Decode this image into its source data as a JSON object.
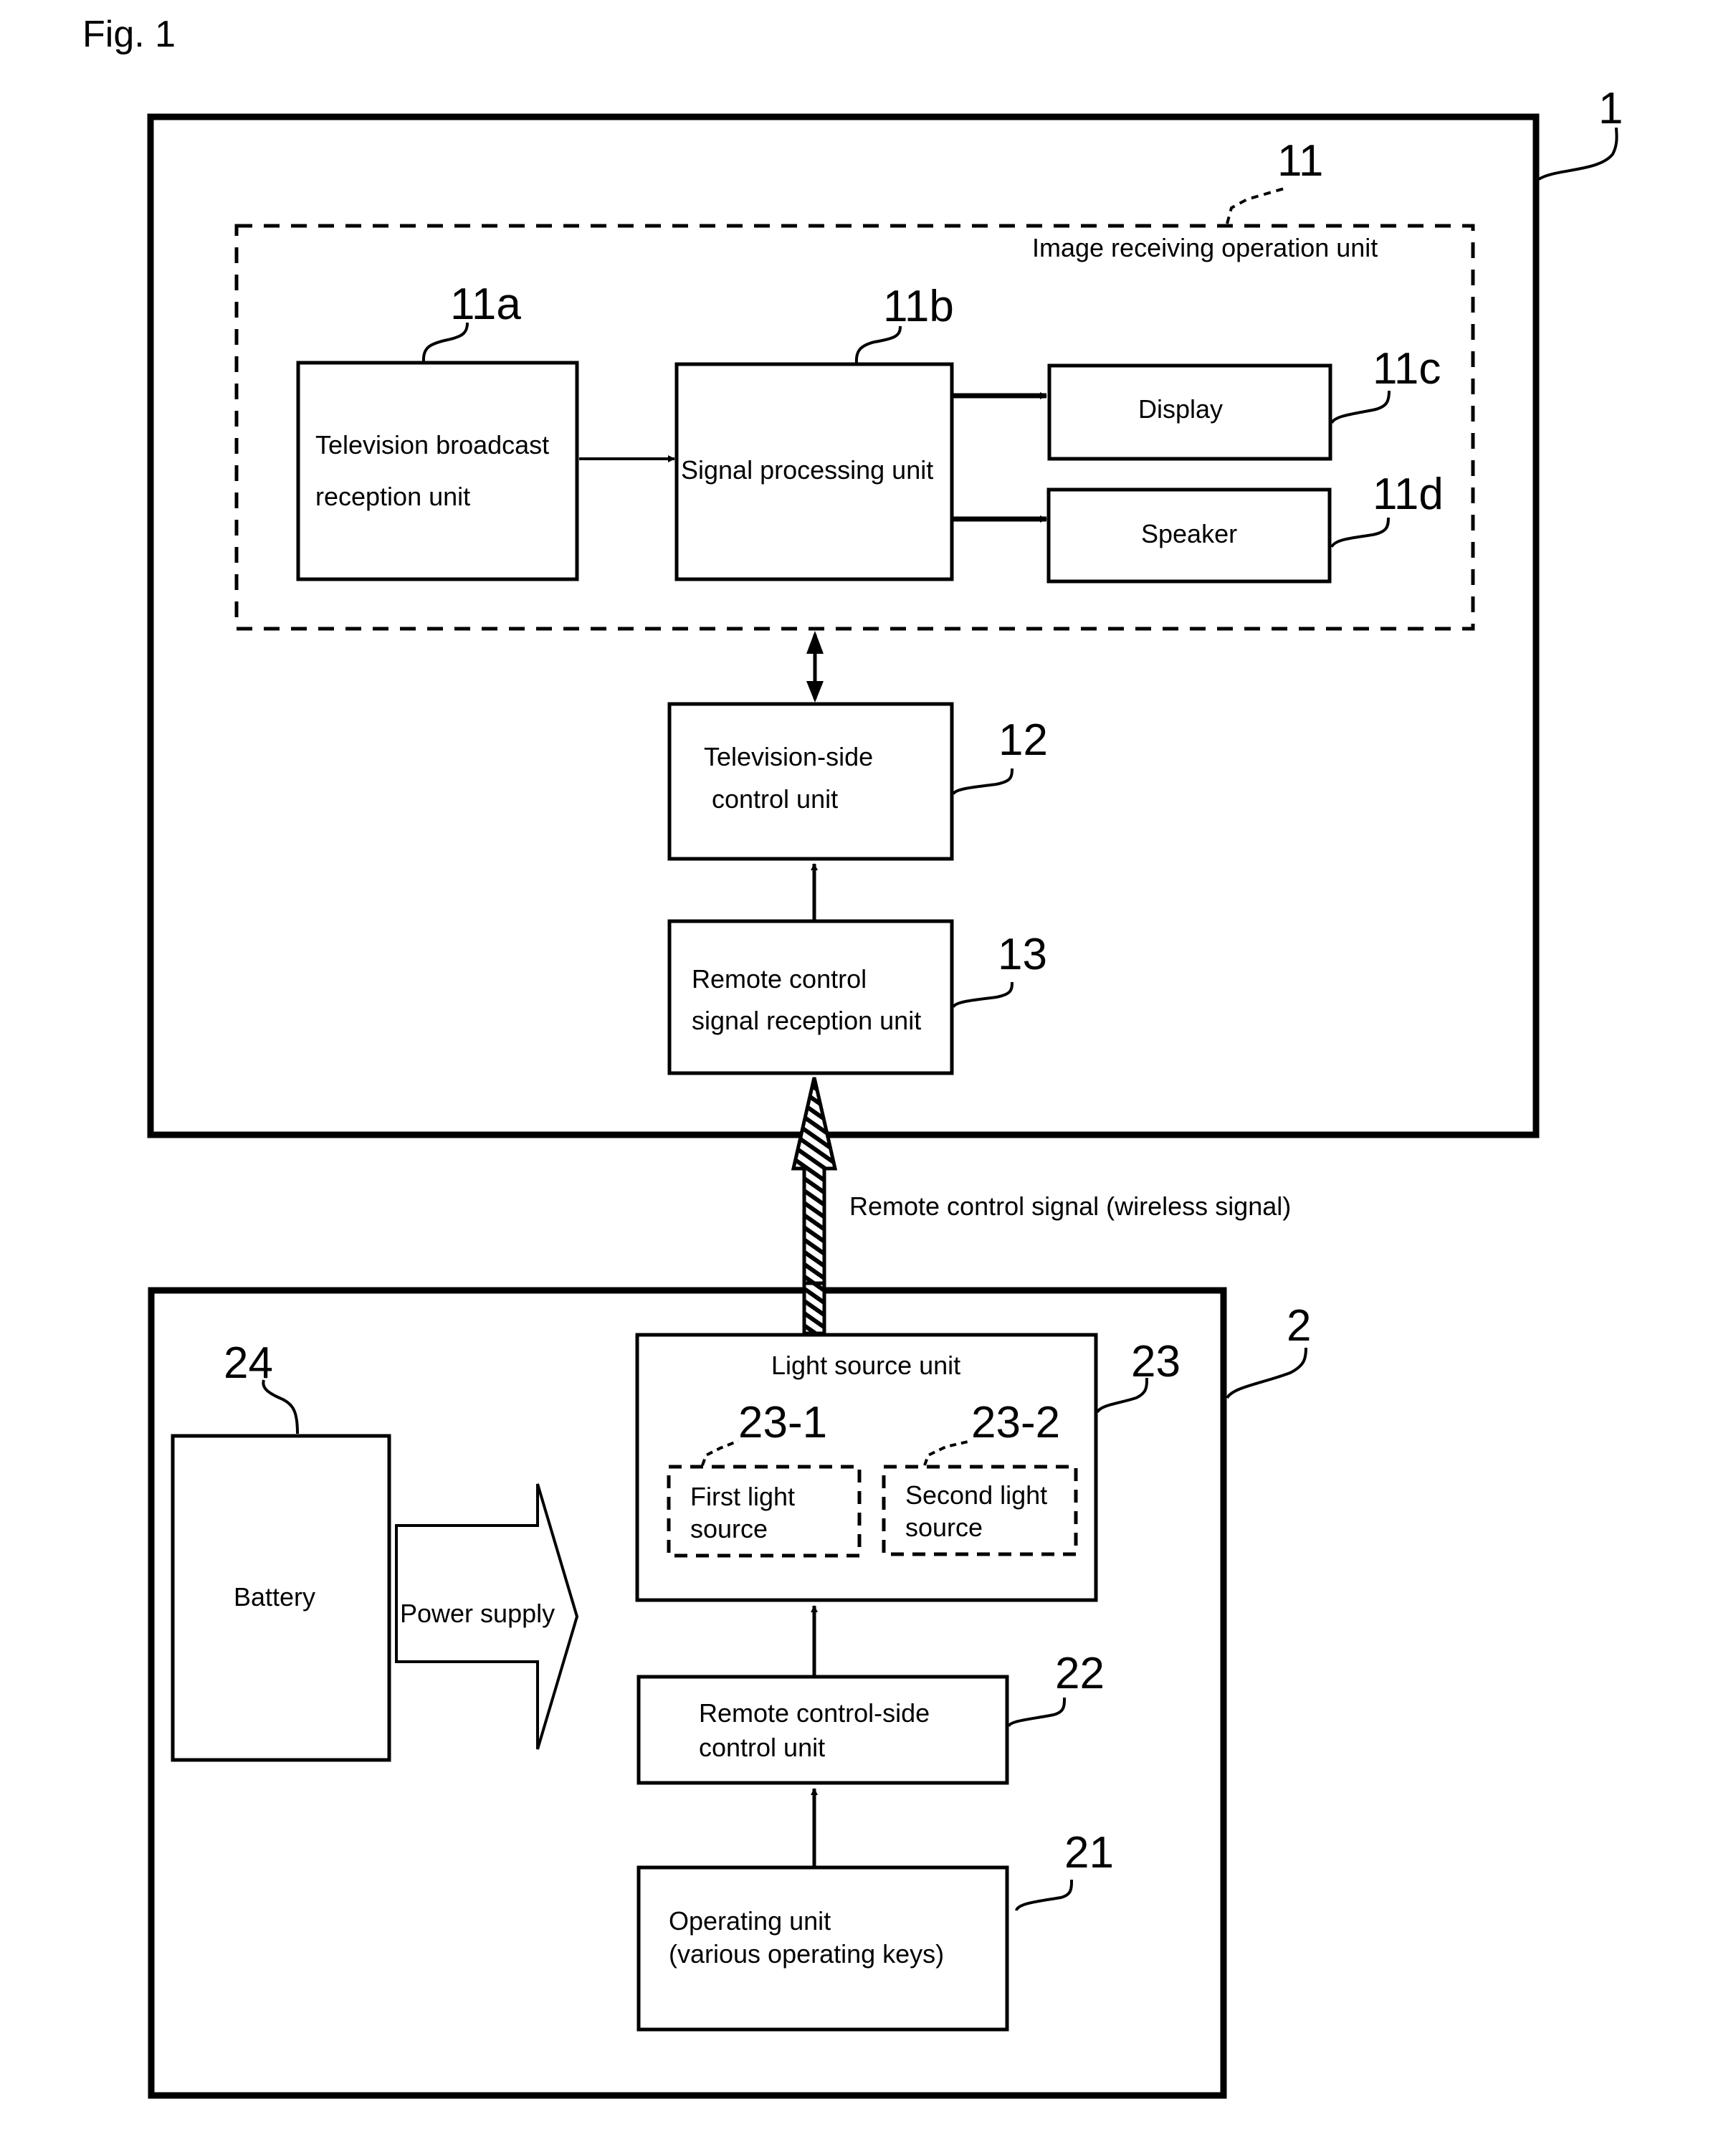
{
  "figure_title": "Fig. 1",
  "television": {
    "ref": "1",
    "image_receiving_unit": {
      "ref": "11",
      "label": "Image receiving operation unit",
      "broadcast_reception": {
        "ref": "11a",
        "lines": [
          "Television broadcast",
          "reception unit"
        ]
      },
      "signal_processing": {
        "ref": "11b",
        "label": "Signal processing unit"
      },
      "display": {
        "ref": "11c",
        "label": "Display"
      },
      "speaker": {
        "ref": "11d",
        "label": "Speaker"
      }
    },
    "tv_control": {
      "ref": "12",
      "lines": [
        "Television-side",
        "control unit"
      ]
    },
    "remote_reception": {
      "ref": "13",
      "lines": [
        "Remote control",
        "signal reception unit"
      ]
    }
  },
  "wireless_signal_label": "Remote control signal (wireless signal)",
  "remote": {
    "ref": "2",
    "light_source_unit": {
      "ref": "23",
      "label": "Light source unit",
      "first": {
        "ref": "23-1",
        "lines": [
          "First light",
          "source"
        ]
      },
      "second": {
        "ref": "23-2",
        "lines": [
          "Second light",
          "source"
        ]
      }
    },
    "battery": {
      "ref": "24",
      "label": "Battery"
    },
    "power_supply_label": "Power supply",
    "remote_control_unit": {
      "ref": "22",
      "lines": [
        "Remote control-side",
        "control unit"
      ]
    },
    "operating_unit": {
      "ref": "21",
      "lines": [
        "Operating unit",
        "(various operating keys)"
      ]
    }
  }
}
